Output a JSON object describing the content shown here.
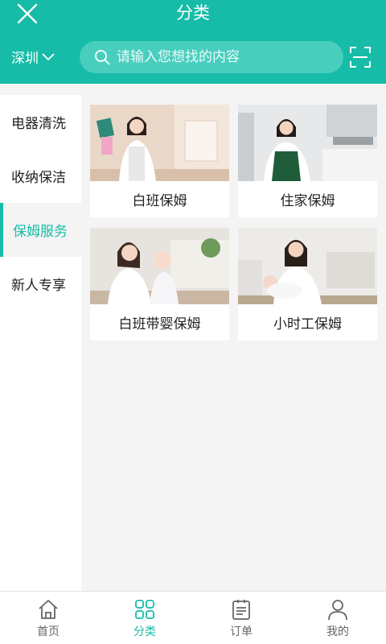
{
  "header": {
    "title": "分类",
    "city": "深圳",
    "search_placeholder": "请输入您想找的内容",
    "accent_color": "#16bca7"
  },
  "sidebar": {
    "items": [
      {
        "label": "电器清洗",
        "active": false
      },
      {
        "label": "收纳保洁",
        "active": false
      },
      {
        "label": "保姆服务",
        "active": true
      },
      {
        "label": "新人专享",
        "active": false
      }
    ]
  },
  "cards": [
    {
      "label": "白班保姆"
    },
    {
      "label": "住家保姆"
    },
    {
      "label": "白班带婴保姆"
    },
    {
      "label": "小时工保姆"
    }
  ],
  "tabbar": {
    "items": [
      {
        "label": "首页",
        "icon": "home-icon"
      },
      {
        "label": "分类",
        "icon": "category-icon",
        "active": true
      },
      {
        "label": "订单",
        "icon": "order-icon"
      },
      {
        "label": "我的",
        "icon": "profile-icon"
      }
    ]
  }
}
